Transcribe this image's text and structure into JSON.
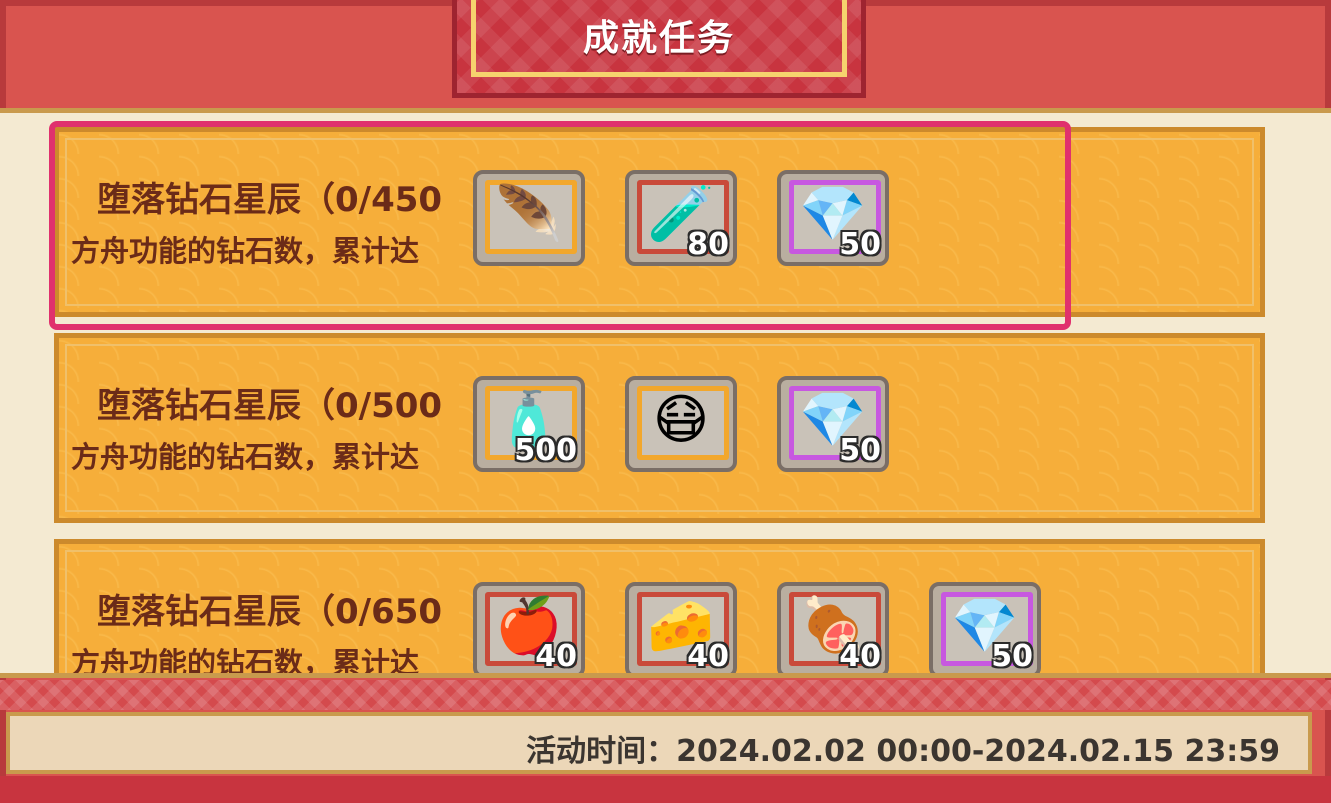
{
  "header": {
    "title": "成就任务"
  },
  "tasks": [
    {
      "title": "堕落钻石星辰（0/450",
      "desc": "方舟功能的钻石数，累计达",
      "rewards": [
        {
          "icon": "feather-bundle-icon",
          "glyph": "🪶",
          "qty": "",
          "frame": "orange"
        },
        {
          "icon": "bottle-icon",
          "glyph": "🧪",
          "qty": "80",
          "frame": "red"
        },
        {
          "icon": "gem-icon",
          "glyph": "💎",
          "qty": "50",
          "frame": "purple"
        }
      ]
    },
    {
      "title": "堕落钻石星辰（0/500",
      "desc": "方舟功能的钻石数，累计达",
      "rewards": [
        {
          "icon": "potion-icon",
          "glyph": "🧴",
          "qty": "500",
          "frame": "orange"
        },
        {
          "icon": "gas-mask-icon",
          "glyph": "😷",
          "qty": "",
          "frame": "orange"
        },
        {
          "icon": "gem-icon",
          "glyph": "💎",
          "qty": "50",
          "frame": "purple"
        }
      ]
    },
    {
      "title": "堕落钻石星辰（0/650",
      "desc": "方舟功能的钻石数，累计达",
      "rewards": [
        {
          "icon": "apple-icon",
          "glyph": "🍎",
          "qty": "40",
          "frame": "red"
        },
        {
          "icon": "cheese-icon",
          "glyph": "🧀",
          "qty": "40",
          "frame": "red"
        },
        {
          "icon": "meat-icon",
          "glyph": "🍖",
          "qty": "40",
          "frame": "red"
        },
        {
          "icon": "gem-icon",
          "glyph": "💎",
          "qty": "50",
          "frame": "purple"
        }
      ]
    }
  ],
  "footer": {
    "event_time": "活动时间：2024.02.02 00:00-2024.02.15 23:59"
  }
}
